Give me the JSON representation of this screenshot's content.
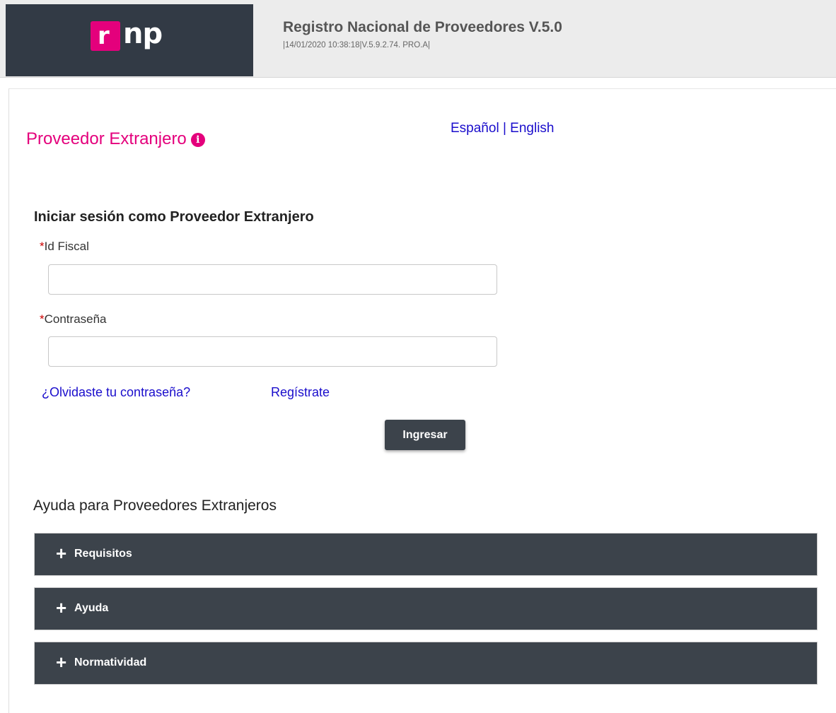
{
  "header": {
    "logo": {
      "letter": "r",
      "rest": "np"
    },
    "title": "Registro Nacional de Proveedores V.5.0",
    "meta": "|14/01/2020 10:38:18|V.5.9.2.74. PRO.A|"
  },
  "page": {
    "title": "Proveedor Extranjero",
    "info_icon": "info-circle-icon"
  },
  "language": {
    "spanish": "Español",
    "separator": "|",
    "english": "English"
  },
  "login": {
    "heading": "Iniciar sesión como Proveedor Extranjero",
    "fiscal_id_label": "Id Fiscal",
    "fiscal_id_value": "",
    "password_label": "Contraseña",
    "password_value": "",
    "required_mark": "*",
    "forgot_password": "¿Olvidaste tu contraseña?",
    "register": "Regístrate",
    "submit": "Ingresar"
  },
  "help": {
    "heading": "Ayuda para Proveedores Extranjeros",
    "sections": [
      {
        "label": "Requisitos",
        "icon": "plus-icon"
      },
      {
        "label": "Ayuda",
        "icon": "plus-icon"
      },
      {
        "label": "Normatividad",
        "icon": "plus-icon"
      }
    ]
  },
  "colors": {
    "header_bg": "#ececec",
    "logo_bg": "#323a45",
    "accent_pink": "#e4007c",
    "link_blue": "#1a0dcc",
    "button_bg": "#3c434b"
  }
}
